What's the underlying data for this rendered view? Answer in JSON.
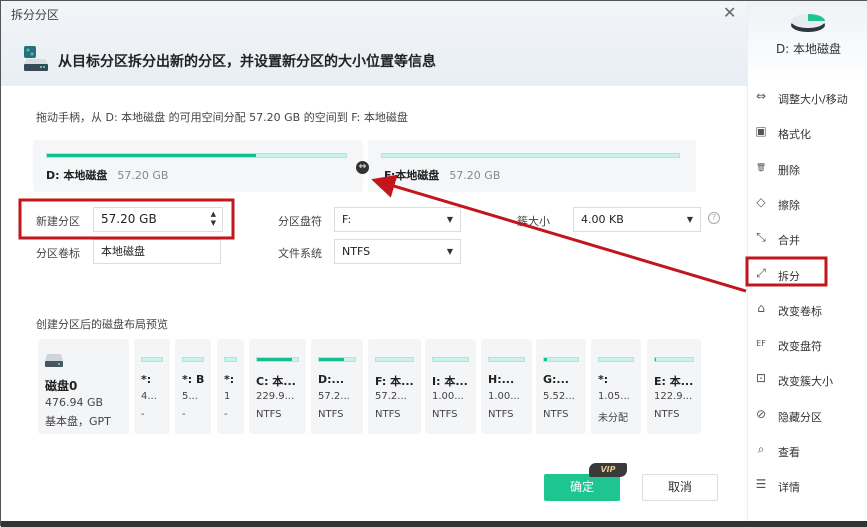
{
  "window": {
    "title": "拆分分区",
    "close_icon": "close-icon"
  },
  "header": {
    "text": "从目标分区拆分出新的分区，并设置新分区的大小位置等信息",
    "icon": "disk-split-icon"
  },
  "hint": "拖动手柄，从 D: 本地磁盘 的可用空间分配 57.20  GB 的空间到 F: 本地磁盘",
  "partitions": [
    {
      "name": "D: 本地磁盘",
      "size": "57.20  GB",
      "used_percent": 70
    },
    {
      "name": "F:本地磁盘",
      "size": "57.20  GB",
      "used_percent": 0
    }
  ],
  "handle_icon": "resize-handle-icon",
  "form": {
    "new_partition_label": "新建分区",
    "new_partition_value": "57.20  GB",
    "volume_label_label": "分区卷标",
    "volume_label_value": "本地磁盘",
    "drive_letter_label": "分区盘符",
    "drive_letter_value": "F:",
    "filesystem_label": "文件系统",
    "filesystem_value": "NTFS",
    "cluster_label": "簇大小",
    "cluster_value": "4.00 KB",
    "help_icon": "help-icon"
  },
  "preview": {
    "title": "创建分区后的磁盘布局预览",
    "disk": {
      "name": "磁盘0",
      "size": "476.94  GB",
      "type": "基本盘，GPT"
    },
    "cards": [
      {
        "name": "*:",
        "size": "4...",
        "fs": "-",
        "used_percent": 0
      },
      {
        "name": "*: B",
        "size": "5...",
        "fs": "-",
        "used_percent": 0
      },
      {
        "name": "*:",
        "size": "1",
        "fs": "-",
        "used_percent": 0
      },
      {
        "name": "C: 本...",
        "size": "229.9...",
        "fs": "NTFS",
        "used_percent": 85
      },
      {
        "name": "D:...",
        "size": "57.2...",
        "fs": "NTFS",
        "used_percent": 70
      },
      {
        "name": "F: 本...",
        "size": "57.2...",
        "fs": "NTFS",
        "used_percent": 0
      },
      {
        "name": "I: 本...",
        "size": "1.00...",
        "fs": "NTFS",
        "used_percent": 0
      },
      {
        "name": "H:...",
        "size": "1.00...",
        "fs": "NTFS",
        "used_percent": 0
      },
      {
        "name": "G:...",
        "size": "5.52...",
        "fs": "NTFS",
        "used_percent": 10
      },
      {
        "name": "*:",
        "size": "1.05...",
        "fs": "未分配",
        "used_percent": 0
      },
      {
        "name": "E: 本...",
        "size": "122.9...",
        "fs": "NTFS",
        "used_percent": 2
      }
    ]
  },
  "buttons": {
    "ok": "确定",
    "vip": "VIP",
    "cancel": "取消"
  },
  "sidebar": {
    "disk_name": "D: 本地磁盘",
    "items": [
      {
        "label": "调整大小/移动",
        "icon": "resize-icon",
        "glyph": "⇔"
      },
      {
        "label": "格式化",
        "icon": "format-icon",
        "glyph": "▣"
      },
      {
        "label": "删除",
        "icon": "trash-icon",
        "glyph": "🗑"
      },
      {
        "label": "擦除",
        "icon": "eraser-icon",
        "glyph": "◇"
      },
      {
        "label": "合并",
        "icon": "merge-icon",
        "glyph": "⤡"
      },
      {
        "label": "拆分",
        "icon": "split-icon",
        "glyph": "⤢"
      },
      {
        "label": "改变卷标",
        "icon": "tag-icon",
        "glyph": "⌂"
      },
      {
        "label": "改变盘符",
        "icon": "drive-letter-icon",
        "glyph": "EF"
      },
      {
        "label": "改变簇大小",
        "icon": "cluster-icon",
        "glyph": "⊡"
      },
      {
        "label": "隐藏分区",
        "icon": "hide-icon",
        "glyph": "⊘"
      },
      {
        "label": "查看",
        "icon": "view-icon",
        "glyph": "⌕"
      },
      {
        "label": "详情",
        "icon": "details-icon",
        "glyph": "☰"
      }
    ]
  },
  "colors": {
    "accent": "#1fc591",
    "annotation": "#c0161c"
  }
}
